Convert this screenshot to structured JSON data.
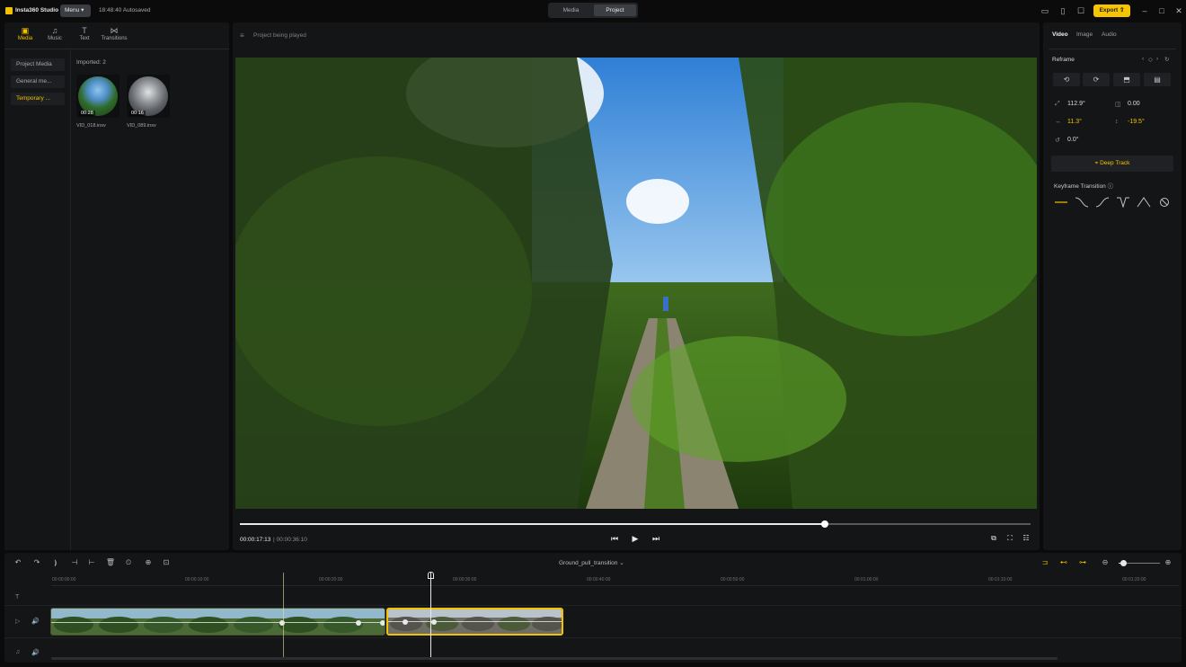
{
  "app": {
    "name": "Insta360 Studio",
    "menu_label": "Menu",
    "autosave": "18:48:40 Autosaved",
    "mode_tabs": [
      "Media",
      "Project"
    ],
    "export_label": "Export"
  },
  "left_panel": {
    "tabs": [
      {
        "label": "Media",
        "icon": "folder-icon"
      },
      {
        "label": "Music",
        "icon": "music-note-icon"
      },
      {
        "label": "Text",
        "icon": "text-icon"
      },
      {
        "label": "Transitions",
        "icon": "transition-icon"
      }
    ],
    "side_items": [
      "Project Media",
      "General me...",
      "Temporary ..."
    ],
    "imported_label": "Imported: 2",
    "clips": [
      {
        "name": "VID_018.insv",
        "duration": "00:28"
      },
      {
        "name": "VID_089.insv",
        "duration": "00:16"
      }
    ]
  },
  "preview": {
    "status": "Project being played",
    "current_time": "00:00:17:13",
    "total_time": "| 00:00:36:10",
    "progress": 0.74
  },
  "right_panel": {
    "tabs": [
      "Video",
      "Image",
      "Audio"
    ],
    "reframe_label": "Reframe",
    "fields": {
      "fov": "112.9°",
      "distortion": "0.00",
      "pan": "11.3°",
      "tilt": "-19.5°",
      "roll": "0.0°"
    },
    "deep_track_label": "Deep Track",
    "keyframe_transition_label": "Keyframe Transition"
  },
  "timeline": {
    "project_name": "Ground_pull_transition",
    "ticks": [
      "00:00:00:00",
      "00:00:10:00",
      "00:00:20:00",
      "00:00:30:00",
      "00:00:40:00",
      "00:00:50:00",
      "00:01:00:00",
      "00:01:10:00",
      "00:01:20:00"
    ],
    "zoom_level": 0.1
  },
  "colors": {
    "accent": "#f2c200",
    "background": "#0b0b0c",
    "panel": "#141516"
  }
}
